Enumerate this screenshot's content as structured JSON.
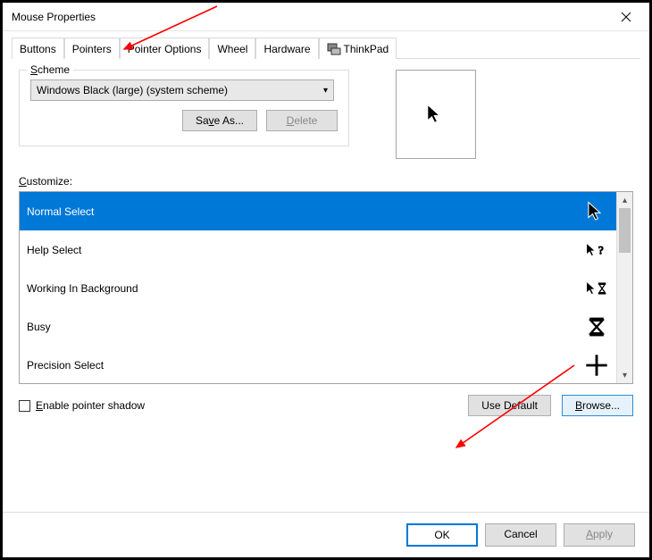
{
  "window": {
    "title": "Mouse Properties"
  },
  "tabs": {
    "items": [
      {
        "label": "Buttons"
      },
      {
        "label": "Pointers"
      },
      {
        "label": "Pointer Options"
      },
      {
        "label": "Wheel"
      },
      {
        "label": "Hardware"
      },
      {
        "label": "ThinkPad"
      }
    ]
  },
  "scheme": {
    "legend": "Scheme",
    "selected": "Windows Black (large) (system scheme)",
    "save_as": "Save As...",
    "delete": "Delete"
  },
  "customize": {
    "label": "Customize:",
    "items": [
      {
        "label": "Normal Select",
        "selected": true,
        "icon": "arrow"
      },
      {
        "label": "Help Select",
        "selected": false,
        "icon": "arrow-help"
      },
      {
        "label": "Working In Background",
        "selected": false,
        "icon": "arrow-hourglass"
      },
      {
        "label": "Busy",
        "selected": false,
        "icon": "hourglass"
      },
      {
        "label": "Precision Select",
        "selected": false,
        "icon": "crosshair"
      }
    ]
  },
  "enable_shadow": "Enable pointer shadow",
  "use_default": "Use Default",
  "browse": "Browse...",
  "footer": {
    "ok": "OK",
    "cancel": "Cancel",
    "apply": "Apply"
  }
}
